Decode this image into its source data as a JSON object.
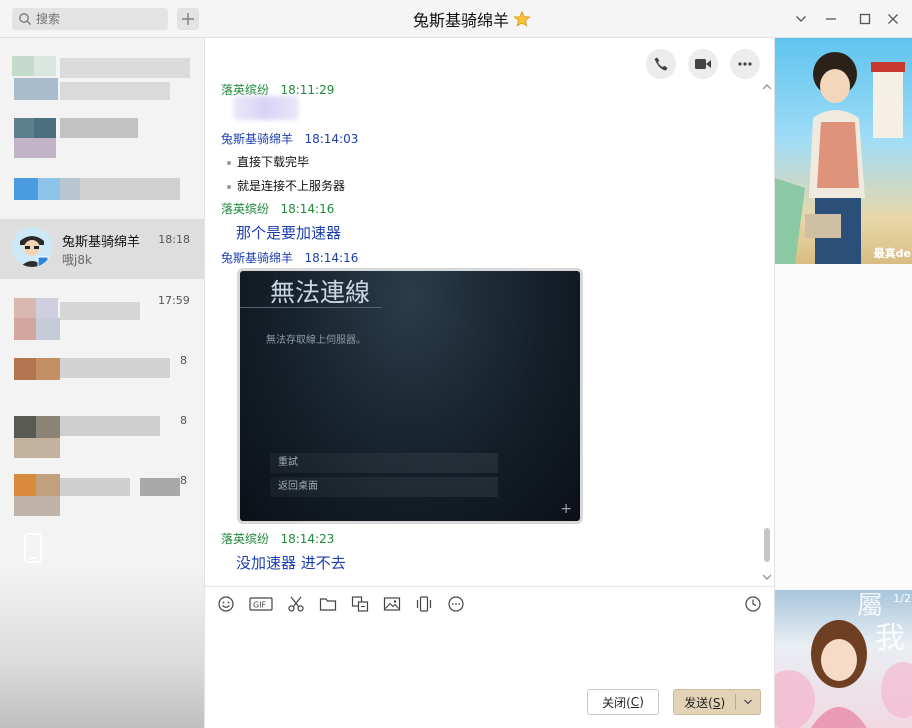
{
  "search": {
    "placeholder": "搜索"
  },
  "window": {
    "title": "兔斯基骑绵羊"
  },
  "contacts": {
    "selected": {
      "name": "兔斯基骑绵羊",
      "time": "18:18",
      "preview": "哦j8k"
    },
    "other_times": [
      "17:59",
      "8",
      "8",
      "8"
    ]
  },
  "chat": {
    "messages": [
      {
        "sender": "落英缤纷",
        "time": "18:11:29"
      },
      {
        "sender": "兔斯基骑绵羊",
        "time": "18:14:03",
        "lines": [
          "直接下载完毕",
          "就是连接不上服务器"
        ]
      },
      {
        "sender": "落英缤纷",
        "time": "18:14:16",
        "text": "那个是要加速器"
      },
      {
        "sender": "兔斯基骑绵羊",
        "time": "18:14:16",
        "image": {
          "heading": "無法連線",
          "body": "無法存取線上伺服器。",
          "options": [
            "重試",
            "返回桌面"
          ]
        }
      },
      {
        "sender": "落英缤纷",
        "time": "18:14:23",
        "text": "没加速器 进不去"
      }
    ]
  },
  "composer": {
    "close_label": "关闭(",
    "close_key": "C",
    "close_suffix": ")",
    "send_label": "发送(",
    "send_key": "S",
    "send_suffix": ")"
  },
  "right_panel": {
    "top_caption": "最真de",
    "bottom_page": "1/2"
  },
  "colors": {
    "sender_self": "#1e8a3a",
    "sender_peer": "#1c3fb0",
    "send_button": "#e2d2b6"
  },
  "icons": [
    "search-icon",
    "plus-icon",
    "star-icon",
    "chevron-down-icon",
    "minimize-icon",
    "maximize-icon",
    "close-icon",
    "phone-icon",
    "video-icon",
    "more-icon",
    "emoji-icon",
    "gif-icon",
    "scissors-icon",
    "folder-icon",
    "translate-icon",
    "image-icon",
    "shake-icon",
    "more-tools-icon",
    "history-icon"
  ]
}
